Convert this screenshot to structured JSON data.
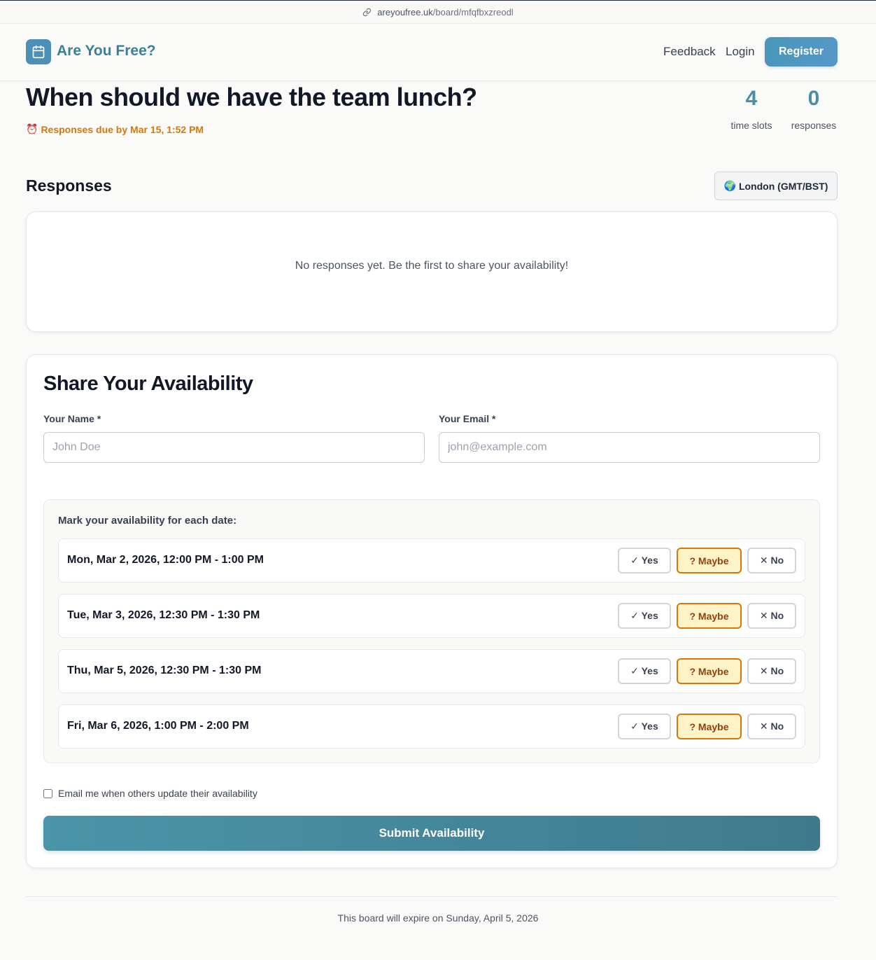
{
  "browser": {
    "url_domain": "areyoufree.uk",
    "url_path": "/board/mfqfbxzreodl",
    "link_icon": "link-icon"
  },
  "header": {
    "logo_icon": "calendar-icon",
    "brand": "Are You Free?",
    "nav": {
      "feedback": "Feedback",
      "login": "Login",
      "register": "Register"
    }
  },
  "board": {
    "title": "When should we have the team lunch?",
    "due_icon": "⏰",
    "due_text": "Responses due by Mar 15, 1:52 PM",
    "stats": {
      "time_slots_value": "4",
      "time_slots_label": "time slots",
      "responses_value": "0",
      "responses_label": "responses"
    }
  },
  "responses": {
    "heading": "Responses",
    "timezone_icon": "🌍",
    "timezone": "London (GMT/BST)",
    "empty_message": "No responses yet. Be the first to share your availability!"
  },
  "form": {
    "heading": "Share Your Availability",
    "name_label": "Your Name *",
    "name_placeholder": "John Doe",
    "email_label": "Your Email *",
    "email_placeholder": "john@example.com",
    "availability_heading": "Mark your availability for each date:",
    "slots": [
      {
        "label": "Mon, Mar 2, 2026, 12:00 PM - 1:00 PM",
        "selected": "maybe"
      },
      {
        "label": "Tue, Mar 3, 2026, 12:30 PM - 1:30 PM",
        "selected": "maybe"
      },
      {
        "label": "Thu, Mar 5, 2026, 12:30 PM - 1:30 PM",
        "selected": "maybe"
      },
      {
        "label": "Fri, Mar 6, 2026, 1:00 PM - 2:00 PM",
        "selected": "maybe"
      }
    ],
    "options": {
      "yes": "✓ Yes",
      "maybe": "? Maybe",
      "no": "✕ No"
    },
    "notify_label": "Email me when others update their availability",
    "notify_checked": false,
    "submit": "Submit Availability"
  },
  "footer": {
    "text": "This board will expire on Sunday, April 5, 2026"
  },
  "colors": {
    "accent": "#4b8ea6",
    "brand": "#3d7f96",
    "warning": "#d97706",
    "maybe_bg": "#fef3c7"
  }
}
